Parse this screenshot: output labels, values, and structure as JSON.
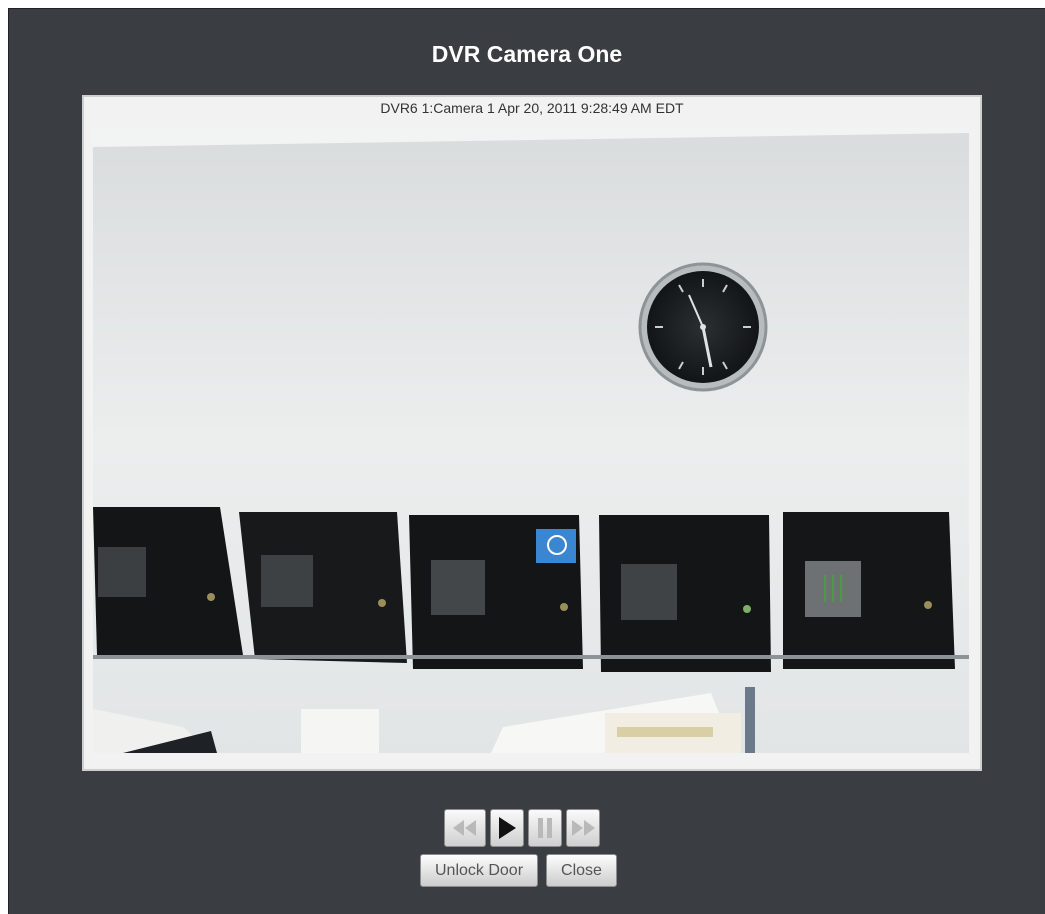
{
  "dialog": {
    "title": "DVR Camera One"
  },
  "video": {
    "caption": "DVR6 1:Camera 1 Apr 20, 2011 9:28:49 AM EDT"
  },
  "media_controls": {
    "rewind_icon": "rewind-icon",
    "play_icon": "play-icon",
    "pause_icon": "pause-icon",
    "fast_forward_icon": "fast-forward-icon"
  },
  "actions": {
    "unlock_label": "Unlock Door",
    "close_label": "Close"
  },
  "colors": {
    "dialog_bg": "#3a3d42",
    "title_text": "#ffffff",
    "button_text": "#555555"
  }
}
